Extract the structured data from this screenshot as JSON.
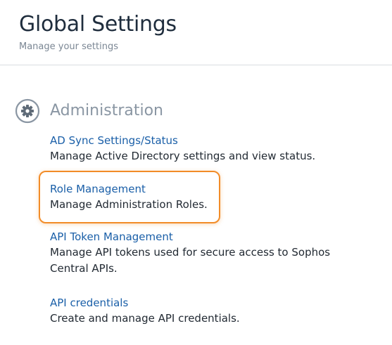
{
  "header": {
    "title": "Global Settings",
    "subtitle": "Manage your settings"
  },
  "section": {
    "title": "Administration",
    "icon": "gear-icon"
  },
  "settings": [
    {
      "link": "AD Sync Settings/Status",
      "description": "Manage Active Directory settings and view status."
    },
    {
      "link": "Role Management",
      "description": "Manage Administration Roles."
    },
    {
      "link": "API Token Management",
      "description": "Manage API tokens used for secure access to Sophos Central APIs."
    },
    {
      "link": "API credentials",
      "description": "Create and manage API credentials."
    }
  ],
  "colors": {
    "link": "#1a5fa8",
    "highlight": "#f28c28",
    "section_title": "#8a96a3"
  }
}
